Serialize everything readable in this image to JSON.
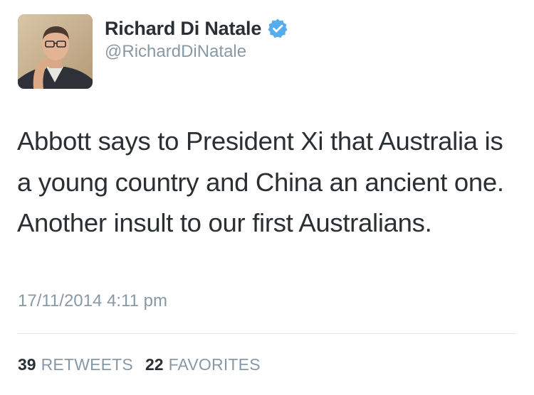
{
  "tweet": {
    "author": {
      "display_name": "Richard Di Natale",
      "handle": "@RichardDiNatale",
      "verified_icon": "verified-badge-icon",
      "verified_color": "#55acee"
    },
    "text": "Abbott says to President Xi that Australia is a young country and China an ancient one. Another insult to our first Australians.",
    "timestamp": "17/11/2014 4:11 pm",
    "stats": {
      "retweets_count": "39",
      "retweets_label": "RETWEETS",
      "favorites_count": "22",
      "favorites_label": "FAVORITES"
    }
  }
}
